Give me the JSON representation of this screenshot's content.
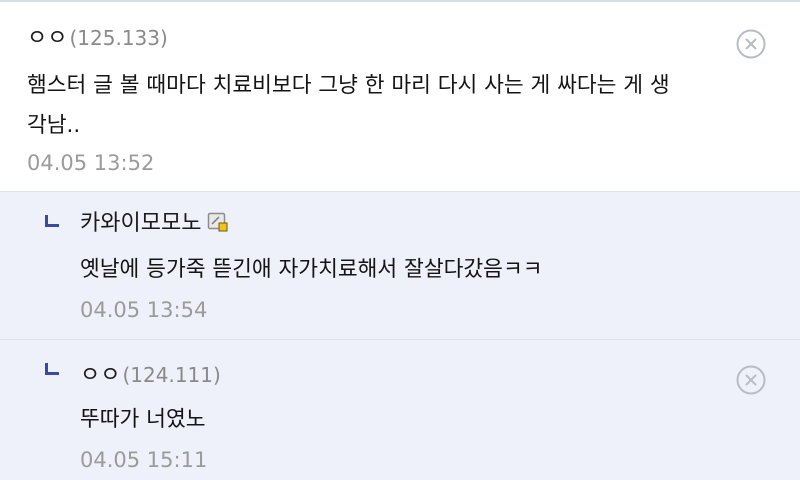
{
  "comments": [
    {
      "nickname": "ㅇㅇ",
      "ip": "(125.133)",
      "text_line1": "햄스터 글 볼 때마다 치료비보다 그냥 한 마리 다시 사는 게 싸다는 게 생",
      "text_line2": "각남..",
      "timestamp": "04.05 13:52"
    },
    {
      "nickname": "카와이모모노",
      "text": "옛날에 등가죽 뜯긴애 자가치료해서 잘살다갔음ㅋㅋ",
      "timestamp": "04.05 13:54"
    },
    {
      "nickname": "ㅇㅇ",
      "ip": "(124.111)",
      "text": "뚜따가 너였노",
      "timestamp": "04.05 15:11"
    }
  ],
  "icons": {
    "delete": "close-circle-icon",
    "reply": "reply-arrow-icon",
    "member_badge": "fixed-nick-badge-icon"
  },
  "colors": {
    "reply_background": "#eef0fa",
    "reply_arrow": "#3b4a9c",
    "ip_text": "#8a8a8a",
    "timestamp_text": "#9b9b9b"
  }
}
